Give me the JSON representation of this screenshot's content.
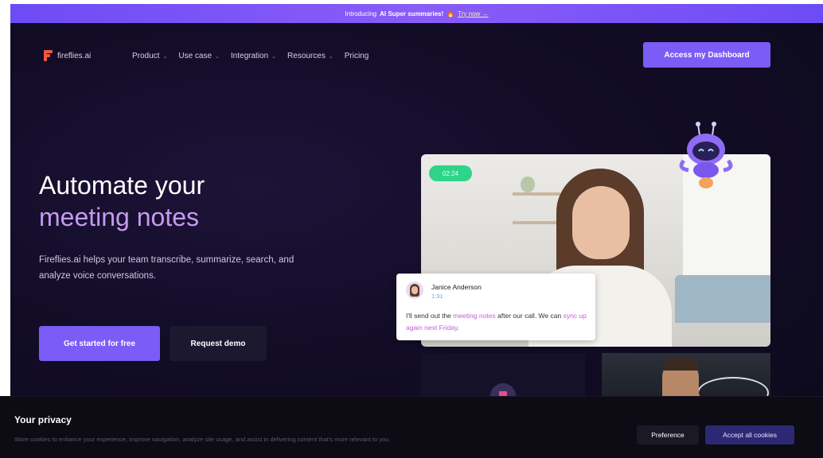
{
  "announcement": {
    "prefix": "Introducing",
    "highlight": "AI Super summaries!",
    "emoji": "🔥",
    "link": "Try now →"
  },
  "nav": {
    "logo_text": "fireflies.ai",
    "items": [
      {
        "label": "Product",
        "has_dropdown": true
      },
      {
        "label": "Use case",
        "has_dropdown": true
      },
      {
        "label": "Integration",
        "has_dropdown": true
      },
      {
        "label": "Resources",
        "has_dropdown": true
      },
      {
        "label": "Pricing",
        "has_dropdown": false
      }
    ],
    "cta": "Access my Dashboard",
    "caret": "⌄"
  },
  "hero": {
    "title_line1": "Automate your",
    "title_line2": "meeting notes",
    "subtitle": "Fireflies.ai helps your team transcribe, summarize, search, and analyze voice conversations.",
    "primary_button": "Get started for free",
    "secondary_button": "Request demo"
  },
  "video": {
    "timer": "02:24"
  },
  "chat": {
    "name": "Janice Anderson",
    "time": "1:31",
    "msg_part1": "I'll send out the ",
    "msg_hl1": "meeting notes",
    "msg_part2": " after our call. We can ",
    "msg_hl2": "sync up again next Friday",
    "msg_part3": "."
  },
  "cookie": {
    "title": "Your privacy",
    "text": "Store cookies to enhance your experience, improve navigation, analyze site usage, and assist in delivering content that's more relevant to you.",
    "preference_button": "Preference",
    "accept_button": "Accept all cookies"
  },
  "colors": {
    "accent": "#7c5cf7",
    "title_highlight": "#c69af0",
    "timer_green": "#2dd48a",
    "logo_red": "#f0563f"
  }
}
